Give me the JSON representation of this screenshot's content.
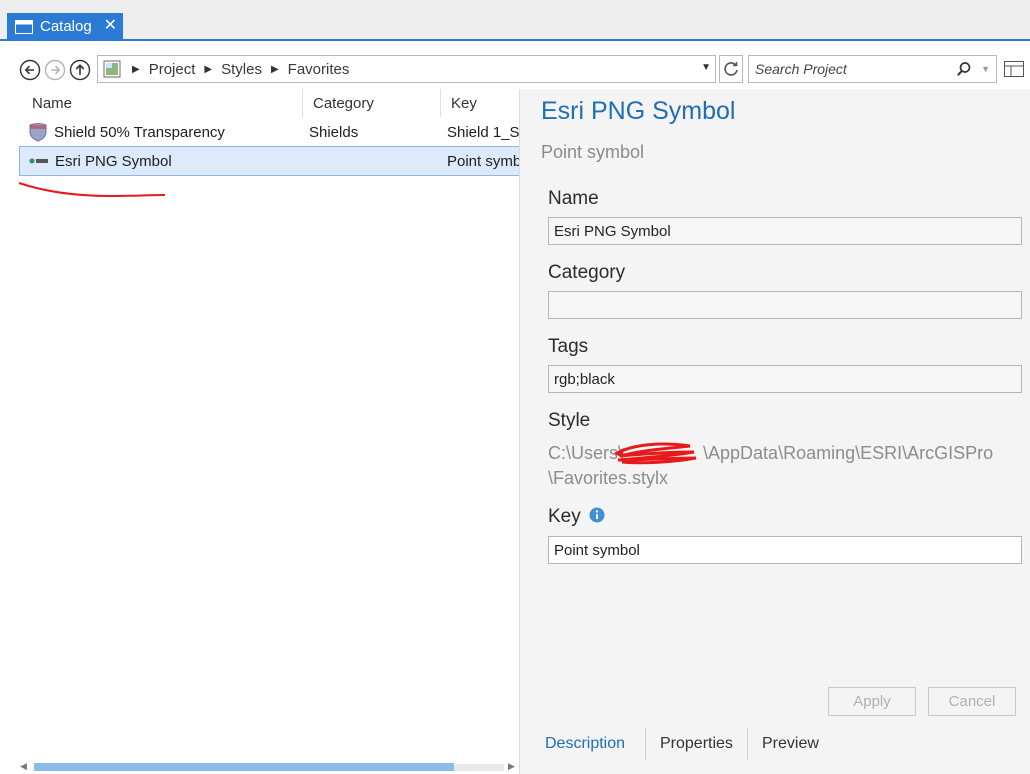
{
  "tab": {
    "label": "Catalog",
    "close": "✕"
  },
  "address": {
    "crumbs": [
      "Project",
      "Styles",
      "Favorites"
    ]
  },
  "search": {
    "placeholder": "Search Project"
  },
  "columns": {
    "name": "Name",
    "category": "Category",
    "key": "Key"
  },
  "rows": [
    {
      "name": "Shield 50% Transparency",
      "category": "Shields",
      "key": "Shield 1_Sh",
      "icon": "shield-icon"
    },
    {
      "name": "Esri PNG Symbol",
      "category": "",
      "key": "Point symb",
      "icon": "png-symbol-icon",
      "selected": true
    }
  ],
  "details": {
    "title": "Esri PNG Symbol",
    "subtitle": "Point symbol",
    "name_label": "Name",
    "name_value": "Esri PNG Symbol",
    "category_label": "Category",
    "category_value": "",
    "tags_label": "Tags",
    "tags_value": "rgb;black",
    "style_label": "Style",
    "style_path_line1_a": "C:\\Users\\",
    "style_path_line1_b": "\\AppData\\Roaming\\ESRI\\ArcGISPro",
    "style_path_line2": "\\Favorites.stylx",
    "key_label": "Key",
    "key_value": "Point symbol"
  },
  "buttons": {
    "apply": "Apply",
    "cancel": "Cancel"
  },
  "bottom_tabs": [
    "Description",
    "Properties",
    "Preview"
  ],
  "colors": {
    "accent": "#2b7bd6",
    "title": "#1f6db5",
    "selection": "#dceafb",
    "annotation_red": "#e8191b"
  }
}
